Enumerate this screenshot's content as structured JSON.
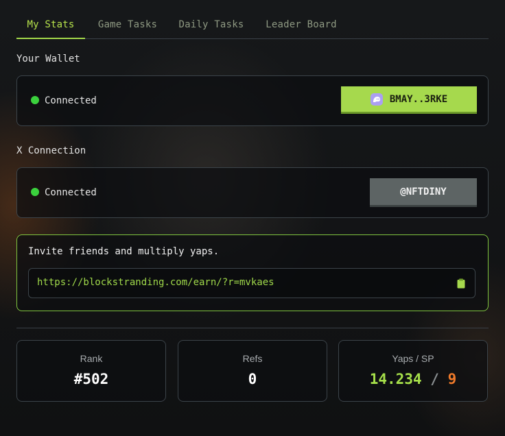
{
  "tabs": [
    {
      "label": "My Stats",
      "active": true
    },
    {
      "label": "Game Tasks",
      "active": false
    },
    {
      "label": "Daily Tasks",
      "active": false
    },
    {
      "label": "Leader Board",
      "active": false
    }
  ],
  "wallet": {
    "section_label": "Your Wallet",
    "status": "Connected",
    "address": "BMAY..3RKE",
    "icon": "phantom-wallet-icon"
  },
  "x_connection": {
    "section_label": "X Connection",
    "status": "Connected",
    "handle": "@NFTDINY"
  },
  "invite": {
    "title": "Invite friends and multiply yaps.",
    "link": "https://blockstranding.com/earn/?r=mvkaes",
    "copy_icon": "clipboard-icon"
  },
  "stats": {
    "rank": {
      "label": "Rank",
      "value": "#502"
    },
    "refs": {
      "label": "Refs",
      "value": "0"
    },
    "yaps": {
      "label": "Yaps / SP",
      "yaps": "14.234",
      "separator": "/",
      "sp": "9"
    }
  },
  "colors": {
    "accent": "#a6d94d",
    "connected": "#3bd13d",
    "sp": "#f07a2a"
  }
}
